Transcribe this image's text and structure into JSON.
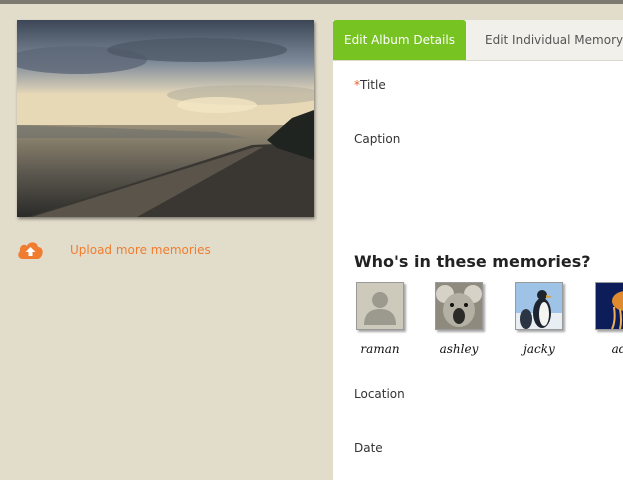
{
  "upload": {
    "label": "Upload more memories"
  },
  "tabs": [
    {
      "label": "Edit Album Details",
      "active": true
    },
    {
      "label": "Edit Individual Memory",
      "active": false
    }
  ],
  "form": {
    "title_required_mark": "*",
    "title_label": "Title",
    "caption_label": "Caption",
    "people_heading": "Who's in these memories?",
    "location_label": "Location",
    "date_label": "Date"
  },
  "people": [
    {
      "name": "raman",
      "avatar": "default-person-icon"
    },
    {
      "name": "ashley",
      "avatar": "koala-photo"
    },
    {
      "name": "jacky",
      "avatar": "penguins-photo"
    },
    {
      "name": "ad",
      "avatar": "jellyfish-photo"
    }
  ],
  "colors": {
    "accent_tab": "#76c322",
    "upload_orange": "#f07d2f",
    "sidebar_bg": "#e2dccb"
  }
}
